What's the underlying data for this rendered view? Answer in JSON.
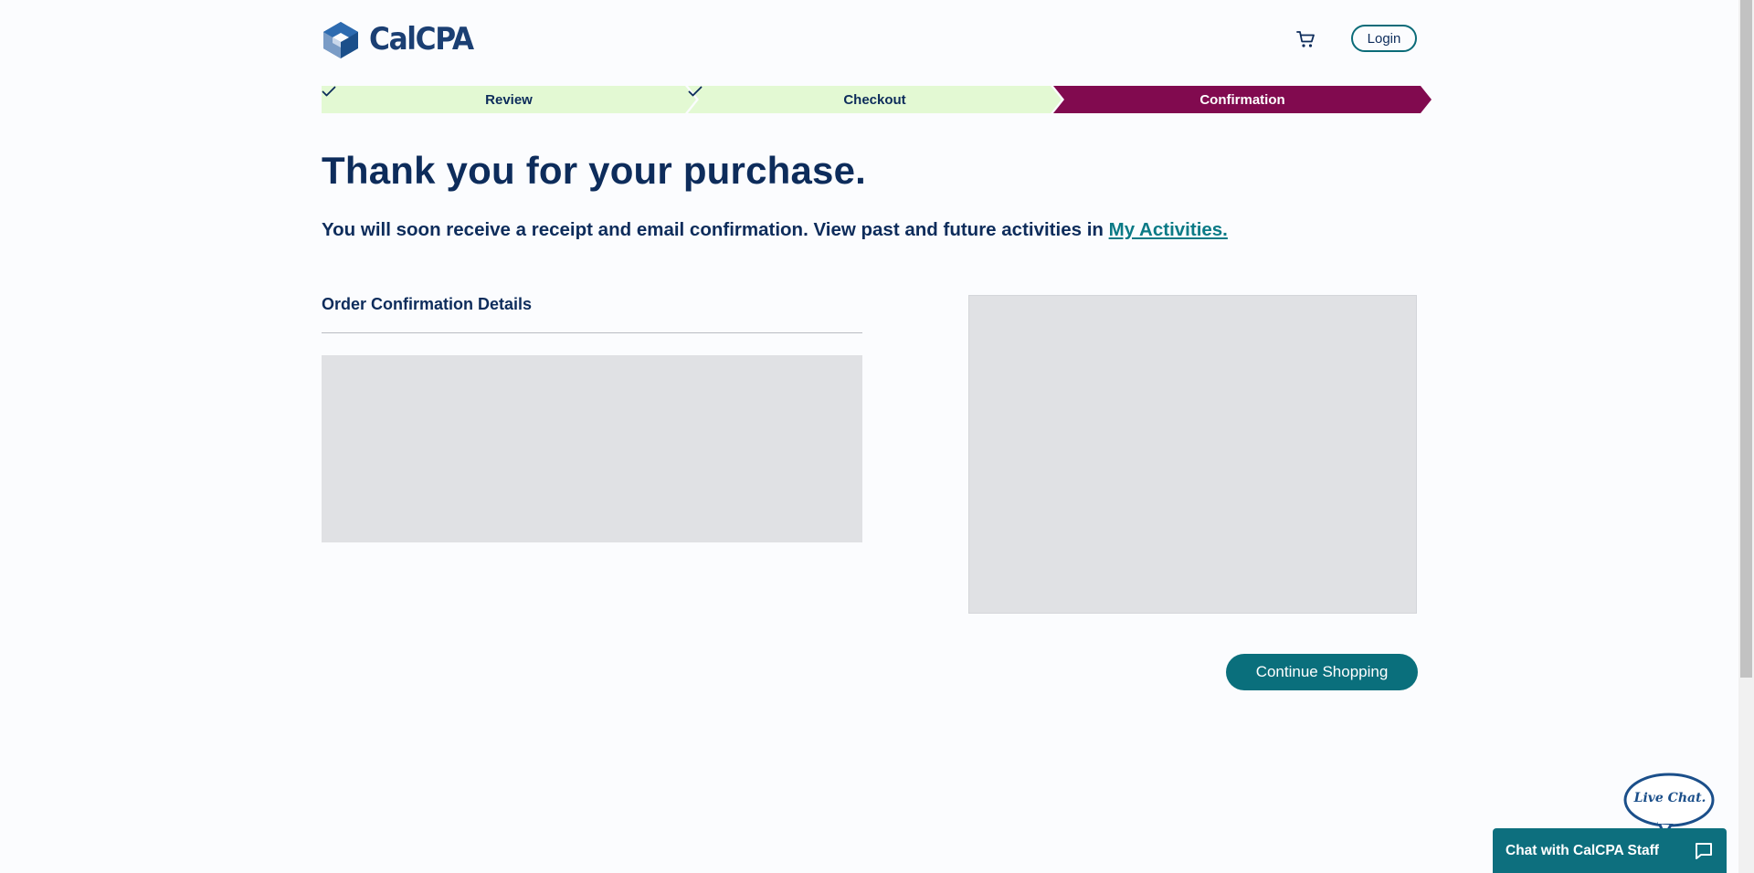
{
  "header": {
    "logo_text": "CalCPA",
    "cart_icon": "cart-icon",
    "login_label": "Login"
  },
  "steps": [
    {
      "label": "Review",
      "status": "done"
    },
    {
      "label": "Checkout",
      "status": "done"
    },
    {
      "label": "Confirmation",
      "status": "current"
    }
  ],
  "main": {
    "heading": "Thank you for your purchase.",
    "notice_text": "You will soon receive a receipt and email confirmation. View past and future activities in ",
    "notice_link": "My Activities.",
    "details_title": "Order Confirmation Details",
    "continue_label": "Continue Shopping"
  },
  "chat": {
    "bubble_label": "Live Chat.",
    "bar_label": "Chat with CalCPA Staff",
    "icon": "chat-bubble-icon"
  },
  "colors": {
    "brand_navy": "#0d2c5b",
    "teal": "#0a6f7c",
    "step_done_bg": "#e3f9d3",
    "step_current_bg": "#810a4f",
    "placeholder": "#e0e1e4"
  }
}
